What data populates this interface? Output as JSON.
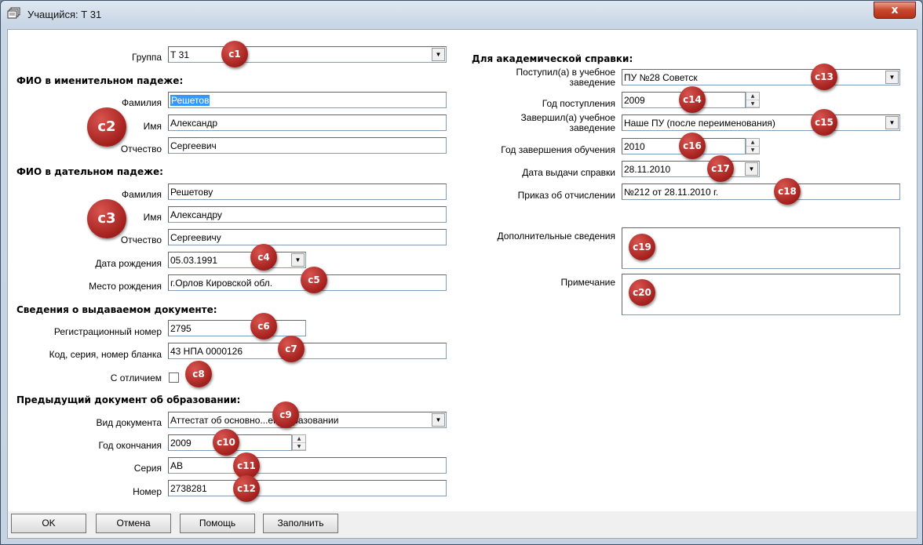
{
  "window": {
    "title": "Учащийся: Т 31",
    "close_symbol": "x"
  },
  "left": {
    "group": {
      "label": "Группа",
      "value": "Т 31"
    },
    "nominative": {
      "header": "ФИО в именительном падеже:",
      "surname_label": "Фамилия",
      "surname": "Решетов",
      "name_label": "Имя",
      "name": "Александр",
      "patronymic_label": "Отчество",
      "patronymic": "Сергеевич"
    },
    "dative": {
      "header": "ФИО в дательном падеже:",
      "surname_label": "Фамилия",
      "surname": "Решетову",
      "name_label": "Имя",
      "name": "Александру",
      "patronymic_label": "Отчество",
      "patronymic": "Сергеевичу"
    },
    "birth_date": {
      "label": "Дата рождения",
      "value": "05.03.1991"
    },
    "birth_place": {
      "label": "Место рождения",
      "value": "г.Орлов Кировской обл."
    },
    "issued": {
      "header": "Сведения о выдаваемом документе:",
      "reg_label": "Регистрационный номер",
      "reg": "2795",
      "code_label": "Код, серия, номер бланка",
      "code": "43 НПА 0000126",
      "honors_label": "С отличием",
      "honors_checked": false
    },
    "previous": {
      "header": "Предыдущий документ об образовании:",
      "type_label": "Вид документа",
      "type": "Аттестат об основно...ем образовании",
      "year_label": "Год окончания",
      "year": "2009",
      "series_label": "Серия",
      "series": "АВ",
      "number_label": "Номер",
      "number": "2738281"
    }
  },
  "right": {
    "header": "Для академической справки:",
    "entered_label_1": "Поступил(а) в учебное",
    "entered_label_2": "заведение",
    "entered": "ПУ №28 Советск",
    "entry_year_label": "Год поступления",
    "entry_year": "2009",
    "finished_label_1": "Завершил(а) учебное",
    "finished_label_2": "заведение",
    "finished": "Наше ПУ (после переименования)",
    "finish_year_label": "Год завершения обучения",
    "finish_year": "2010",
    "issue_date_label": "Дата выдачи справки",
    "issue_date": "28.11.2010",
    "order_label": "Приказ об отчислении",
    "order": "№212 от 28.11.2010 г.",
    "extra_label": "Дополнительные сведения",
    "note_label": "Примечание"
  },
  "badges": {
    "c1": "c1",
    "c2": "c2",
    "c3": "c3",
    "c4": "c4",
    "c5": "c5",
    "c6": "c6",
    "c7": "c7",
    "c8": "c8",
    "c9": "c9",
    "c10": "c10",
    "c11": "c11",
    "c12": "c12",
    "c13": "c13",
    "c14": "c14",
    "c15": "c15",
    "c16": "c16",
    "c17": "c17",
    "c18": "c18",
    "c19": "c19",
    "c20": "c20"
  },
  "buttons": {
    "ok": "OK",
    "cancel": "Отмена",
    "help": "Помощь",
    "fill": "Заполнить"
  },
  "colors": {
    "badge": "#a3201d",
    "selection": "#3399ff"
  }
}
